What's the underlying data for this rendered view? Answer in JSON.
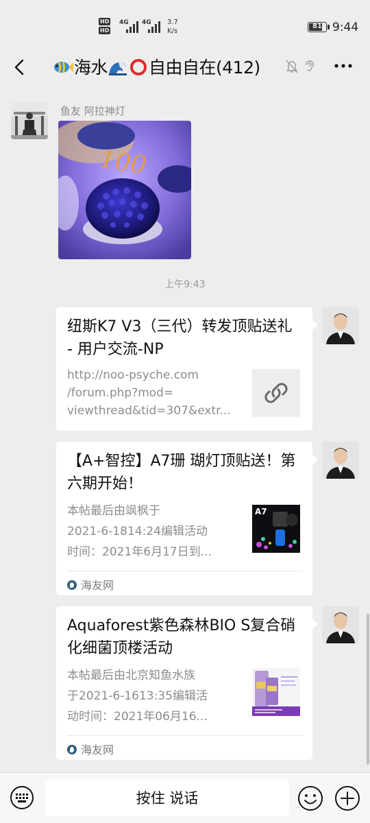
{
  "status_bar": {
    "hd_top": "HD",
    "hd_bottom": "HD",
    "net1": "4G",
    "net2": "4G",
    "speed_value": "3.7",
    "speed_unit": "K/s",
    "battery": "81",
    "time": "9:44"
  },
  "nav": {
    "title_part1": "海水",
    "title_part2": "自由自在(412)",
    "icons": [
      "back-arrow-icon",
      "fish-emoji",
      "wave-emoji",
      "red-circle-emoji",
      "mute-bell-icon",
      "ear-icon",
      "more-icon"
    ]
  },
  "messages": {
    "first": {
      "sender": "鱼友 阿拉神灯",
      "image_text": "100"
    },
    "time": "上午9:43",
    "cards": [
      {
        "title": "纽斯K7 V3（三代）转发顶贴送礼 - 用户交流-NP",
        "desc_lines": [
          "http://noo-psyche.com",
          "/forum.php?mod=",
          "viewthread&tid=307&extr..."
        ],
        "thumb": "link-icon"
      },
      {
        "title": "【A+智控】A7珊 瑚灯顶贴送！第六期开始！",
        "desc_lines": [
          "本帖最后由飒枫于",
          "2021-6-1814:24编辑活动",
          "时间：2021年6月17日到..."
        ],
        "thumb_label": "A7",
        "source": "海友网"
      },
      {
        "title": "Aquaforest紫色森林BIO S复合硝化细菌顶楼活动",
        "desc_lines": [
          "本帖最后由北京知鱼水族",
          "于2021-6-1613:35编辑活",
          "动时间：2021年06月16..."
        ],
        "source": "海友网"
      }
    ]
  },
  "bottom": {
    "talk_label": "按住 说话"
  },
  "colors": {
    "background": "#ededed",
    "card": "#ffffff",
    "muted_text": "#8c8c8c",
    "circle_red": "#e02a2a"
  }
}
